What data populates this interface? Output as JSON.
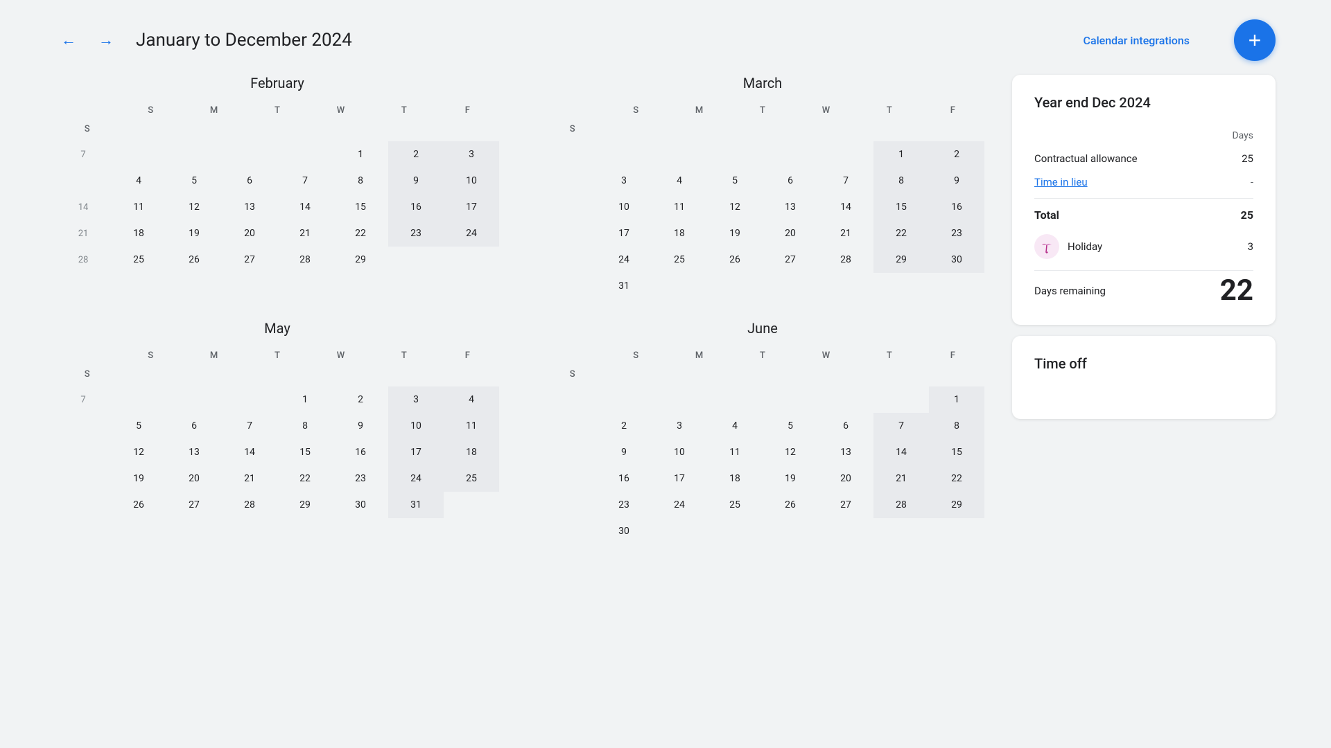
{
  "header": {
    "title": "January to December 2024",
    "calendar_integrations_label": "Calendar integrations",
    "add_button_label": "+"
  },
  "months": [
    {
      "name": "February",
      "day_headers": [
        "S",
        "M",
        "T",
        "W",
        "T",
        "F",
        "S"
      ],
      "weeks": [
        [
          null,
          null,
          null,
          null,
          1,
          2,
          null
        ],
        [
          null,
          5,
          6,
          7,
          8,
          9,
          null
        ],
        [
          null,
          12,
          13,
          14,
          15,
          16,
          null
        ],
        [
          null,
          19,
          20,
          21,
          22,
          23,
          null
        ],
        [
          null,
          26,
          27,
          28,
          29,
          null,
          null
        ]
      ],
      "weekend_days": [
        1,
        7
      ],
      "week_nums": [
        7,
        14,
        21,
        28,
        null
      ],
      "saturdays": [
        3,
        10,
        17,
        24,
        null
      ],
      "sundays": [
        4,
        11,
        18,
        25,
        null
      ]
    },
    {
      "name": "March",
      "day_headers": [
        "S",
        "M",
        "T",
        "W",
        "T",
        "F",
        "S"
      ],
      "weeks": [
        [
          null,
          null,
          null,
          null,
          null,
          1,
          null
        ],
        [
          null,
          4,
          5,
          6,
          7,
          8,
          null
        ],
        [
          null,
          11,
          12,
          13,
          14,
          15,
          null
        ],
        [
          null,
          18,
          19,
          20,
          21,
          22,
          null
        ],
        [
          null,
          25,
          26,
          27,
          28,
          29,
          null
        ]
      ],
      "saturdays": [
        2,
        9,
        16,
        23,
        30
      ],
      "sundays": [
        3,
        10,
        17,
        24,
        31
      ]
    },
    {
      "name": "May",
      "day_headers": [
        "S",
        "M",
        "T",
        "W",
        "T",
        "F",
        "S"
      ],
      "weeks": [
        [
          null,
          null,
          null,
          1,
          2,
          3,
          null
        ],
        [
          null,
          6,
          7,
          8,
          9,
          10,
          null
        ],
        [
          null,
          13,
          14,
          15,
          16,
          17,
          null
        ],
        [
          null,
          20,
          21,
          22,
          23,
          24,
          null
        ],
        [
          null,
          27,
          28,
          29,
          30,
          31,
          null
        ]
      ],
      "saturdays": [
        4,
        11,
        18,
        25,
        null
      ],
      "sundays": [
        5,
        12,
        19,
        26,
        null
      ],
      "week_nums": [
        7,
        null,
        null,
        null,
        null
      ]
    },
    {
      "name": "June",
      "day_headers": [
        "S",
        "M",
        "T",
        "W",
        "T",
        "F",
        "S"
      ],
      "weeks": [
        [
          null,
          null,
          null,
          null,
          null,
          null,
          null
        ],
        [
          null,
          3,
          4,
          5,
          6,
          7,
          null
        ],
        [
          null,
          10,
          11,
          12,
          13,
          14,
          null
        ],
        [
          null,
          17,
          18,
          19,
          20,
          21,
          null
        ],
        [
          null,
          24,
          25,
          26,
          27,
          28,
          null
        ]
      ],
      "saturdays": [
        1,
        8,
        15,
        22,
        29
      ],
      "sundays": [
        2,
        9,
        16,
        23,
        30
      ]
    }
  ],
  "summary_card": {
    "title": "Year end Dec 2024",
    "days_label": "Days",
    "contractual_allowance_label": "Contractual allowance",
    "contractual_allowance_value": "25",
    "time_in_lieu_label": "Time in lieu",
    "time_in_lieu_value": "-",
    "total_label": "Total",
    "total_value": "25",
    "holiday_label": "Holiday",
    "holiday_value": "3",
    "days_remaining_label": "Days remaining",
    "days_remaining_value": "22"
  },
  "time_off_card": {
    "title": "Time off"
  },
  "colors": {
    "accent": "#1a73e8",
    "weekend_bg": "#e8eaed",
    "white": "#ffffff"
  }
}
